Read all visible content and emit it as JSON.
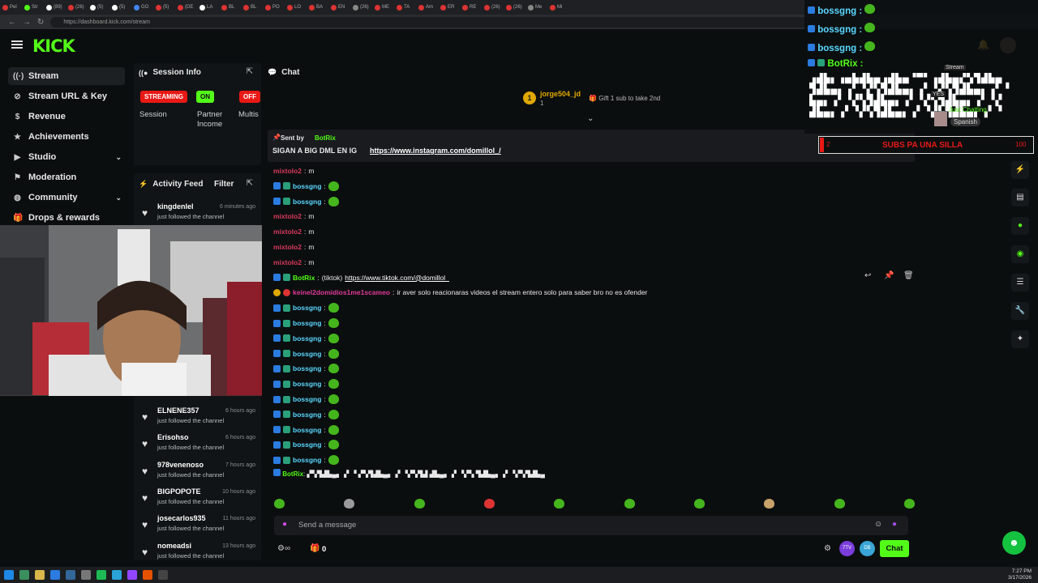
{
  "browser": {
    "url": "https://dashboard.kick.com/stream",
    "tabs": [
      "Pel",
      "Str",
      "(89)",
      "(26)",
      "(5)",
      "(5)",
      "GO",
      "(5)",
      "(DE",
      "LA",
      "BL",
      "BL",
      "PO",
      "LO",
      "BA",
      "EN",
      "(26)",
      "ME",
      "TA",
      "Am",
      "ER",
      "RE",
      "(26)",
      "(26)",
      "Me",
      "Mi"
    ]
  },
  "app": {
    "logo_text": "KICK"
  },
  "sidebar": {
    "items": [
      {
        "label": "Stream",
        "icon": "stream-icon"
      },
      {
        "label": "Stream URL & Key",
        "icon": "key-icon"
      },
      {
        "label": "Revenue",
        "icon": "revenue-icon"
      },
      {
        "label": "Achievements",
        "icon": "achievements-icon"
      },
      {
        "label": "Studio",
        "icon": "studio-icon"
      },
      {
        "label": "Moderation",
        "icon": "moderation-icon"
      },
      {
        "label": "Community",
        "icon": "community-icon"
      },
      {
        "label": "Drops & rewards",
        "icon": "drops-icon"
      }
    ]
  },
  "session": {
    "title": "Session Info",
    "streaming_badge": "STREAMING",
    "on_badge": "ON",
    "off_badge": "OFF",
    "labels": [
      "Session",
      "Partner Income",
      "Multis"
    ]
  },
  "activity": {
    "title": "Activity Feed",
    "filter": "Filter",
    "entries": [
      {
        "user": "kingdenlel",
        "time": "6 minutes ago",
        "text": "just followed the channel"
      },
      {
        "user": "ELNENE357",
        "time": "6 hours ago",
        "text": "just followed the channel"
      },
      {
        "user": "Erisohso",
        "time": "6 hours ago",
        "text": "just followed the channel"
      },
      {
        "user": "978venenoso",
        "time": "7 hours ago",
        "text": "just followed the channel"
      },
      {
        "user": "BIGPOPOTE",
        "time": "10 hours ago",
        "text": "just followed the channel"
      },
      {
        "user": "josecarlos935",
        "time": "11 hours ago",
        "text": "just followed the channel"
      },
      {
        "user": "nomeadsi",
        "time": "13 hours ago",
        "text": "just followed the channel"
      }
    ]
  },
  "chat": {
    "title": "Chat",
    "top_gifter": {
      "user": "jorge504_jd",
      "count": "1"
    },
    "gift_hint": "Gift 1 sub to take 2nd",
    "pinned": {
      "sent_by_label": "Sent by",
      "sender": "BotRix",
      "text": "SIGAN A BIG DML EN IG",
      "link": "https://www.instagram.com/domillol_/"
    },
    "messages": [
      {
        "user": "mixtolo2",
        "color": "#d63a5b",
        "text": "m",
        "badges": false,
        "emote": false
      },
      {
        "user": "bossgng",
        "color": "#5ad7ff",
        "text": "",
        "badges": true,
        "emote": true
      },
      {
        "user": "bossgng",
        "color": "#5ad7ff",
        "text": "",
        "badges": true,
        "emote": true
      },
      {
        "user": "mixtolo2",
        "color": "#d63a5b",
        "text": "m",
        "badges": false,
        "emote": false
      },
      {
        "user": "mixtolo2",
        "color": "#d63a5b",
        "text": "m",
        "badges": false,
        "emote": false
      },
      {
        "user": "mixtolo2",
        "color": "#d63a5b",
        "text": "m",
        "badges": false,
        "emote": false
      },
      {
        "user": "mixtolo2",
        "color": "#d63a5b",
        "text": "m",
        "badges": false,
        "emote": false
      },
      {
        "user": "BotRix",
        "color": "#53fc18",
        "text": "(tiktok)",
        "link": "https://www.tiktok.com/@domillol_",
        "badges": true,
        "emote": false
      },
      {
        "user": "keinel2domidios1me1scameo",
        "color": "#e03a9a",
        "text": "ir aver solo reacionaras videos el stream entero solo para saber bro no es ofender",
        "badges": false,
        "emote": false
      },
      {
        "user": "bossgng",
        "color": "#5ad7ff",
        "text": "",
        "badges": true,
        "emote": true
      },
      {
        "user": "bossgng",
        "color": "#5ad7ff",
        "text": "",
        "badges": true,
        "emote": true
      },
      {
        "user": "bossgng",
        "color": "#5ad7ff",
        "text": "",
        "badges": true,
        "emote": true
      },
      {
        "user": "bossgng",
        "color": "#5ad7ff",
        "text": "",
        "badges": true,
        "emote": true
      },
      {
        "user": "bossgng",
        "color": "#5ad7ff",
        "text": "",
        "badges": true,
        "emote": true
      },
      {
        "user": "bossgng",
        "color": "#5ad7ff",
        "text": "",
        "badges": true,
        "emote": true
      },
      {
        "user": "bossgng",
        "color": "#5ad7ff",
        "text": "",
        "badges": true,
        "emote": true
      },
      {
        "user": "bossgng",
        "color": "#5ad7ff",
        "text": "",
        "badges": true,
        "emote": true
      },
      {
        "user": "bossgng",
        "color": "#5ad7ff",
        "text": "",
        "badges": true,
        "emote": true
      },
      {
        "user": "bossgng",
        "color": "#5ad7ff",
        "text": "",
        "badges": true,
        "emote": true
      },
      {
        "user": "bossgng",
        "color": "#5ad7ff",
        "text": "",
        "badges": true,
        "emote": true
      }
    ],
    "last_message": {
      "user": "BotRix",
      "color": "#53fc18",
      "text": "▞▚▜▟▙▄▖▗▘▝ ▞▚▜▟▙▄▖▗▘▝▞▚▜▟ ▟▙▄▖▗▘▝▞▚ ▜▟▙▄▖▗▘▝▞▚▜▟▙▄"
    },
    "input_placeholder": "Send a message",
    "points": "0",
    "chat_button": "Chat",
    "ext_labels": [
      "7TV",
      "DB"
    ]
  },
  "overlay": {
    "names": [
      "bossgng :",
      "bossgng :",
      "bossgng :",
      "BotRix :"
    ],
    "stream_label": "Stream",
    "just_chatting": "Just Chatting",
    "language": "Spanish",
    "goal_text": "SUBS PA UNA SILLA",
    "goal_left": "2",
    "goal_right": "100",
    "yes_label": "YES"
  },
  "taskbar": {
    "time": "7:27 PM",
    "date": "3/17/2026"
  },
  "colors": {
    "accent": "#53fc18",
    "danger": "#e91916",
    "bg": "#0b0e0f"
  }
}
